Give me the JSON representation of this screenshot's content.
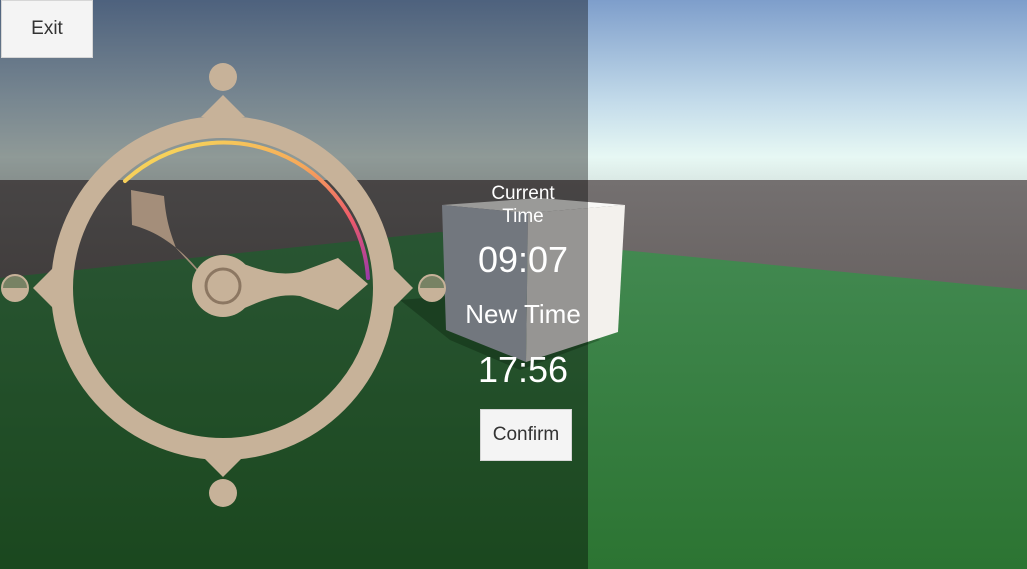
{
  "toolbar": {
    "exit_label": "Exit"
  },
  "time_panel": {
    "current_label": "Current\nTime",
    "current_value": "09:07",
    "new_label": "New Time",
    "new_value": "17:56",
    "confirm_label": "Confirm"
  },
  "dial": {
    "color": "#c7b299",
    "arc_gradient": [
      "#f7e15a",
      "#f6a85a",
      "#ee5a6a",
      "#9b3aa8"
    ]
  },
  "scene": {
    "sky_top": "#7f9fcc",
    "sky_horizon": "#e6f6f3",
    "ground_far": "#6c6664",
    "grass": "#2f7a36",
    "cube": "#ececec"
  }
}
